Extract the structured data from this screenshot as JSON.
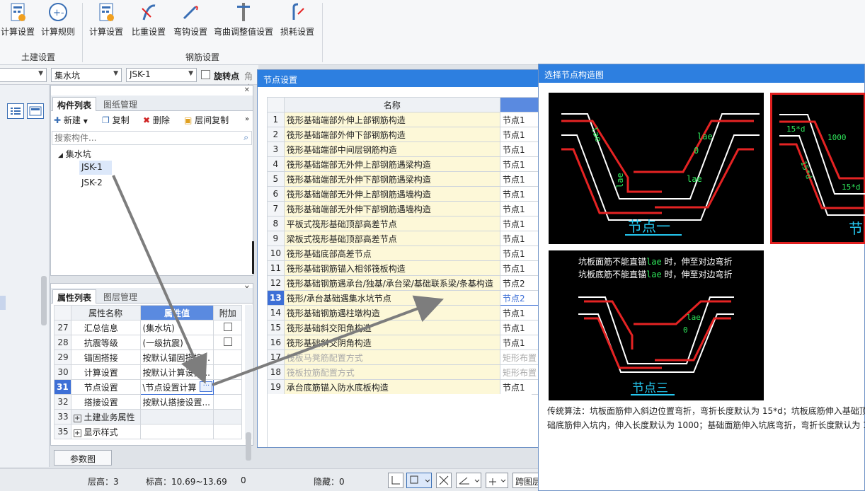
{
  "ribbon": {
    "civil_buttons": [
      {
        "label": "计算设置",
        "icon": "calc-settings-icon"
      },
      {
        "label": "计算规则",
        "icon": "calc-rules-icon"
      }
    ],
    "civil_group": "土建设置",
    "rebar_buttons": [
      {
        "label": "计算设置",
        "icon": "calc-settings-icon"
      },
      {
        "label": "比重设置",
        "icon": "density-settings-icon"
      },
      {
        "label": "弯钩设置",
        "icon": "hook-settings-icon"
      },
      {
        "label": "弯曲调整值设置",
        "icon": "bend-adjust-icon"
      },
      {
        "label": "损耗设置",
        "icon": "loss-settings-icon"
      }
    ],
    "rebar_group": "钢筋设置"
  },
  "toolbar": {
    "combo_category": "集水坑",
    "combo_component": "JSK-1",
    "rotate_point": "旋转点",
    "angle_label": "角度"
  },
  "component_panel": {
    "tab_active": "构件列表",
    "tab_inactive": "图纸管理",
    "new_label": "新建",
    "copy_label": "复制",
    "delete_label": "删除",
    "floor_copy_label": "层间复制",
    "search_placeholder": "搜索构件...",
    "tree_root": "集水坑",
    "tree_items": [
      "JSK-1",
      "JSK-2"
    ]
  },
  "property_panel": {
    "tab_active": "属性列表",
    "tab_inactive": "图层管理",
    "col_name": "属性名称",
    "col_value": "属性值",
    "col_extra": "附加",
    "rows": [
      {
        "num": "27",
        "name": "汇总信息",
        "value": "(集水坑)",
        "check": true
      },
      {
        "num": "28",
        "name": "抗震等级",
        "value": "(一级抗震)",
        "check": true
      },
      {
        "num": "29",
        "name": "锚固搭接",
        "value": "按默认锚固搭接...",
        "check": false
      },
      {
        "num": "30",
        "name": "计算设置",
        "value": "按默认计算设置...",
        "check": false
      },
      {
        "num": "31",
        "name": "节点设置",
        "value": "\\节点设置计算",
        "check": false
      },
      {
        "num": "32",
        "name": "搭接设置",
        "value": "按默认搭接设置...",
        "check": false
      },
      {
        "num": "33",
        "name": "土建业务属性",
        "value": "",
        "check": false
      },
      {
        "num": "35",
        "name": "显示样式",
        "value": "",
        "check": false
      }
    ],
    "param_button": "参数图"
  },
  "status": {
    "floor_height": "层高：3",
    "elevation": "标高：10.69~13.69",
    "zero": "0",
    "hidden": "隐藏：0",
    "cross_layer": "跨图层"
  },
  "node_dialog": {
    "title": "节点设置",
    "col_name": "名称",
    "rows": [
      {
        "num": "1",
        "name": "筏形基础端部外伸上部钢筋构造",
        "value": "节点1"
      },
      {
        "num": "2",
        "name": "筏形基础端部外伸下部钢筋构造",
        "value": "节点1"
      },
      {
        "num": "3",
        "name": "筏形基础端部中间层钢筋构造",
        "value": "节点1"
      },
      {
        "num": "4",
        "name": "筏形基础端部无外伸上部钢筋遇梁构造",
        "value": "节点1"
      },
      {
        "num": "5",
        "name": "筏形基础端部无外伸下部钢筋遇梁构造",
        "value": "节点1"
      },
      {
        "num": "6",
        "name": "筏形基础端部无外伸上部钢筋遇墙构造",
        "value": "节点1"
      },
      {
        "num": "7",
        "name": "筏形基础端部无外伸下部钢筋遇墙构造",
        "value": "节点1"
      },
      {
        "num": "8",
        "name": "平板式筏形基础顶部高差节点",
        "value": "节点1"
      },
      {
        "num": "9",
        "name": "梁板式筏形基础顶部高差节点",
        "value": "节点1"
      },
      {
        "num": "10",
        "name": "筏形基础底部高差节点",
        "value": "节点1"
      },
      {
        "num": "11",
        "name": "筏形基础钢筋锚入相邻筏板构造",
        "value": "节点1"
      },
      {
        "num": "12",
        "name": "筏形基础钢筋遇承台/独基/承台梁/基础联系梁/条基构造",
        "value": "节点2"
      },
      {
        "num": "13",
        "name": "筏形/承台基础遇集水坑节点",
        "value": "节点2"
      },
      {
        "num": "14",
        "name": "筏形基础钢筋遇柱墩构造",
        "value": "节点1"
      },
      {
        "num": "15",
        "name": "筏形基础斜交阳角构造",
        "value": "节点1"
      },
      {
        "num": "16",
        "name": "筏形基础斜交阴角构造",
        "value": "节点1"
      },
      {
        "num": "17",
        "name": "筏板马凳筋配置方式",
        "value": "矩形布置"
      },
      {
        "num": "18",
        "name": "筏板拉筋配置方式",
        "value": "矩形布置"
      },
      {
        "num": "19",
        "name": "承台底筋锚入防水底板构造",
        "value": "节点1"
      }
    ]
  },
  "diagram_dialog": {
    "title": "选择节点构造图",
    "node1": {
      "caption": "节点一",
      "lbl_lae1": "lae",
      "lbl_lae2": "lae",
      "lbl_lae3": "lae",
      "lbl_lae4": "lae",
      "lbl_zero": "0"
    },
    "node2": {
      "caption": "节",
      "lbl_15d": "15*d",
      "lbl_1000": "1000",
      "lbl_15d2": "15*d",
      "lbl_15d3": "15*d"
    },
    "node3": {
      "caption": "节点三",
      "note1_a": "坑板面筋不能直锚",
      "note1_b": "lae",
      "note1_c": " 时，伸至对边弯折",
      "note2_a": "坑板底筋不能直锚",
      "note2_b": "lae",
      "note2_c": " 时，伸至对边弯折",
      "lbl_lae": "lae",
      "lbl_zero": "0"
    },
    "desc_line1": "传统算法：坑板面筋伸入斜边位置弯折，弯折长度默认为 15*d；坑板底筋伸入基础顶",
    "desc_line2": "础底筋伸入坑内，伸入长度默认为 1000；基础面筋伸入坑底弯折，弯折长度默认为 1"
  },
  "colors": {
    "title_blue": "#2d7fe0",
    "rebar_red": "#e52323",
    "line_white": "#ffffff",
    "label_green": "#2ee65a",
    "caption_cyan": "#25c8f0"
  }
}
